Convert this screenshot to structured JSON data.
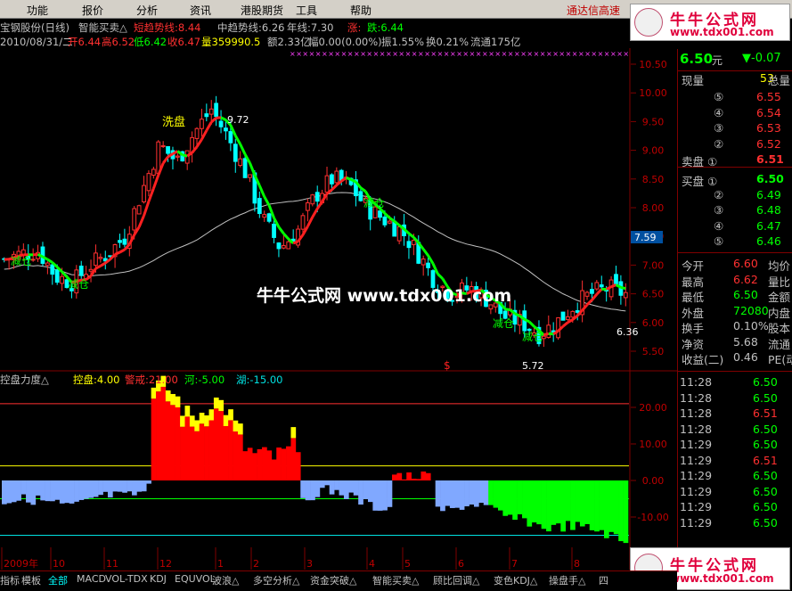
{
  "menu": {
    "items": [
      "功能",
      "报价",
      "分析",
      "资讯",
      "港股期货",
      "工具",
      "帮助"
    ],
    "right_text": "通达信高速"
  },
  "logo": {
    "title": "牛牛公式网",
    "url": "www.tdx001.com"
  },
  "header": {
    "stock": "宝钢股份(日线)",
    "formula": "智能买卖△",
    "short_label": "短趋势线:8.44",
    "mid_label": "中趋势线:6.26",
    "year_label": "年线:7.30",
    "up_label": "涨:",
    "down_label": "跌:6.44",
    "date": "2010/08/31/二",
    "open": "开6.44",
    "high": "高6.52",
    "low": "低6.42",
    "close": "收6.47",
    "volume": "量359990.5",
    "amount": "额2.33亿",
    "change": "幅0.00(0.00%)",
    "amplitude": "振1.55%",
    "turnover": "换0.21%",
    "float": "流通175亿"
  },
  "price_panel": {
    "y_ticks": [
      "10.50",
      "10.00",
      "9.50",
      "9.00",
      "8.50",
      "8.00",
      "7.50",
      "7.00",
      "6.50",
      "6.00",
      "5.50"
    ],
    "current_tag": "7.59",
    "high_mark": "9.72",
    "low_mark": "5.72",
    "right_mark": "6.36",
    "annotations": [
      "洗盘",
      "减仓",
      "减仓",
      "减仓",
      "减仓",
      "减仓"
    ],
    "watermark": "牛牛公式网 www.tdx001.com",
    "dollar": "$"
  },
  "indicator": {
    "name": "控盘力度△",
    "kongpan": "控盘:4.00",
    "jingjie": "警戒:21.00",
    "he": "河:-5.00",
    "hu": "湖:-15.00",
    "y_ticks": [
      "20.00",
      "10.00",
      "0.00",
      "-10.00",
      "-20.00"
    ]
  },
  "x_axis": {
    "labels": [
      "2009年",
      "10",
      "11",
      "12",
      "1",
      "2",
      "3",
      "4",
      "5",
      "6",
      "7",
      "8"
    ]
  },
  "quote": {
    "price": "6.50",
    "price_unit": "元",
    "change": "▼-0.07",
    "xianliang_label": "现量",
    "xianliang_value": "53",
    "zongliang_label": "总量",
    "sell": [
      {
        "n": "⑤",
        "p": "6.55"
      },
      {
        "n": "④",
        "p": "6.54"
      },
      {
        "n": "③",
        "p": "6.53"
      },
      {
        "n": "②",
        "p": "6.52"
      },
      {
        "n": "卖盘 ①",
        "p": "6.51"
      }
    ],
    "buy": [
      {
        "n": "买盘 ①",
        "p": "6.50"
      },
      {
        "n": "②",
        "p": "6.49"
      },
      {
        "n": "③",
        "p": "6.48"
      },
      {
        "n": "④",
        "p": "6.47"
      },
      {
        "n": "⑤",
        "p": "6.46"
      }
    ],
    "stats": [
      {
        "k": "今开",
        "v": "6.60",
        "k2": "均价"
      },
      {
        "k": "最高",
        "v": "6.62",
        "k2": "量比"
      },
      {
        "k": "最低",
        "v": "6.50",
        "k2": "金额"
      },
      {
        "k": "外盘",
        "v": "72080",
        "k2": "内盘"
      },
      {
        "k": "换手",
        "v": "0.10%",
        "k2": "股本"
      },
      {
        "k": "净资",
        "v": "5.68",
        "k2": "流通"
      },
      {
        "k": "收益(二)",
        "v": "0.46",
        "k2": "PE(动"
      }
    ],
    "ticks": [
      {
        "t": "11:28",
        "p": "6.50"
      },
      {
        "t": "11:28",
        "p": "6.50"
      },
      {
        "t": "11:28",
        "p": "6.51"
      },
      {
        "t": "11:28",
        "p": "6.50"
      },
      {
        "t": "11:29",
        "p": "6.50"
      },
      {
        "t": "11:29",
        "p": "6.51"
      },
      {
        "t": "11:29",
        "p": "6.50"
      },
      {
        "t": "11:29",
        "p": "6.50"
      },
      {
        "t": "11:29",
        "p": "6.50"
      },
      {
        "t": "11:29",
        "p": "6.50"
      }
    ]
  },
  "bottom_tabs": [
    "指标",
    "模板",
    "全部",
    "MACD",
    "VOL-TDX",
    "KDJ",
    "EQUVOL",
    "波浪△",
    "多空分析△",
    "资金突破△",
    "智能买卖△",
    "顾比回调△",
    "变色KDJ△",
    "操盘手△",
    "四"
  ],
  "chart_data": {
    "type": "candlestick",
    "title": "宝钢股份(日线)",
    "x": [
      "2009年",
      "10",
      "11",
      "12",
      "1",
      "2",
      "3",
      "4",
      "5",
      "6",
      "7",
      "8"
    ],
    "price_ylim": [
      5.5,
      10.5
    ],
    "close_approx": [
      7.1,
      7.2,
      7.25,
      6.8,
      6.7,
      7.0,
      7.2,
      7.5,
      8.3,
      9.1,
      8.8,
      9.3,
      9.72,
      9.2,
      8.6,
      7.8,
      7.3,
      7.6,
      8.2,
      8.5,
      8.4,
      8.0,
      7.8,
      7.6,
      7.2,
      6.7,
      6.5,
      6.6,
      6.4,
      6.1,
      6.0,
      5.8,
      6.0,
      6.3,
      6.5,
      6.6,
      6.5
    ],
    "indicator_series": {
      "name": "控盘力度",
      "ylim": [
        -25,
        25
      ],
      "reference_lines": [
        21,
        4,
        -5,
        -15
      ]
    }
  }
}
